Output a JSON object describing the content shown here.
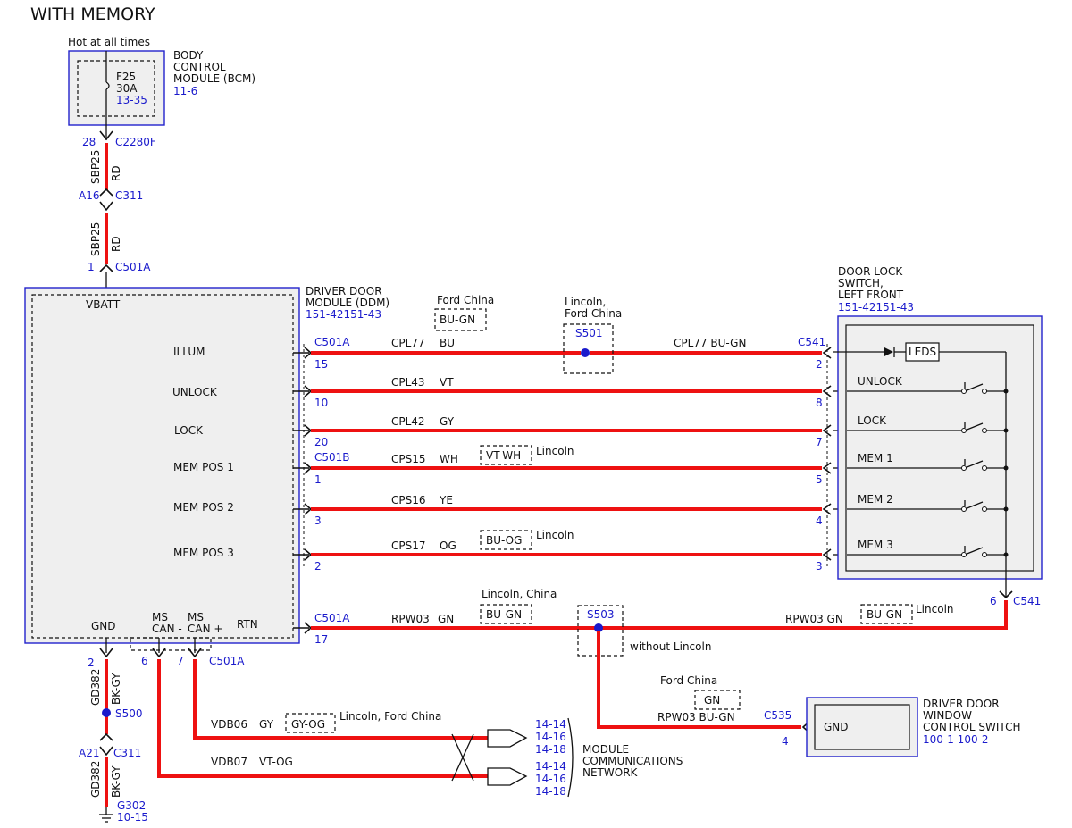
{
  "title": "WITH MEMORY",
  "colors": {
    "wire": "#ee1111",
    "blue_text": "#1a1acc",
    "splice": "#1a1acc",
    "module_fill": "#efefef"
  },
  "bcm": {
    "hot": "Hot at all times",
    "name": [
      "BODY",
      "CONTROL",
      "MODULE (BCM)"
    ],
    "ref": "11-6",
    "fuse": "F25",
    "fuse_amp": "30A",
    "fuse_ref": "13-35"
  },
  "power_feed": {
    "pin1": "28",
    "conn1": "C2280F",
    "circuit1": "SBP25",
    "color1": "RD",
    "pin2": "A16",
    "conn2": "C311",
    "circuit2": "SBP25",
    "color2": "RD",
    "pin3": "1",
    "conn3": "C501A"
  },
  "ddm": {
    "name": [
      "DRIVER DOOR",
      "MODULE (DDM)"
    ],
    "ref": "151-42151-43",
    "vbatt": "VBATT",
    "signals": [
      "ILLUM",
      "UNLOCK",
      "LOCK",
      "MEM POS 1",
      "MEM POS 2",
      "MEM POS 3"
    ],
    "gnd": "GND",
    "ms_can_minus": [
      "MS",
      "CAN -"
    ],
    "ms_can_plus": [
      "MS",
      "CAN +"
    ],
    "rtn": "RTN"
  },
  "switch": {
    "name": [
      "DOOR LOCK",
      "SWITCH,",
      "LEFT FRONT"
    ],
    "ref": "151-42151-43",
    "leds": "LEDS",
    "labels": [
      "UNLOCK",
      "LOCK",
      "MEM 1",
      "MEM 2",
      "MEM 3"
    ]
  },
  "wires": [
    {
      "conn_left": "C501A",
      "pin_left": "15",
      "circuit": "CPL77",
      "color": "BU",
      "pin_right": "2",
      "conn_right": "C541"
    },
    {
      "pin_left": "10",
      "circuit": "CPL43",
      "color": "VT",
      "pin_right": "8"
    },
    {
      "pin_left": "20",
      "circuit": "CPL42",
      "color": "GY",
      "pin_right": "7"
    },
    {
      "conn_left": "C501B",
      "pin_left": "1",
      "circuit": "CPS15",
      "color": "WH",
      "pin_right": "5"
    },
    {
      "pin_left": "3",
      "circuit": "CPS16",
      "color": "YE",
      "pin_right": "4"
    },
    {
      "pin_left": "2",
      "circuit": "CPS17",
      "color": "OG",
      "pin_right": "3"
    }
  ],
  "alt_colors": {
    "illum_note": "Ford China",
    "illum_alt": "BU-GN",
    "s501_note": [
      "Lincoln,",
      "Ford China"
    ],
    "s501": "S501",
    "illum_right": "CPL77  BU-GN",
    "mem1_alt": "VT-WH",
    "mem1_note": "Lincoln",
    "mem3_alt": "BU-OG",
    "mem3_note": "Lincoln"
  },
  "rtn_wire": {
    "conn": "C501A",
    "pin": "17",
    "circuit": "RPW03",
    "color": "GN",
    "note": "Lincoln, China",
    "alt": "BU-GN",
    "splice": "S503",
    "splice_note": "without Lincoln",
    "right_label": "RPW03  GN",
    "right_alt": "BU-GN",
    "right_note": "Lincoln",
    "sw_pin": "6",
    "sw_conn": "C541"
  },
  "window_switch": {
    "note": "Ford China",
    "alt": "GN",
    "wire": "RPW03  BU-GN",
    "conn": "C535",
    "pin": "4",
    "gnd": "GND",
    "name": [
      "DRIVER DOOR",
      "WINDOW",
      "CONTROL SWITCH"
    ],
    "ref": "100-1 100-2"
  },
  "ground": {
    "pin": "2",
    "circuit": "GD382",
    "color": "BK-GY",
    "splice": "S500",
    "pin2": "A21",
    "conn2": "C311",
    "ground": "G302",
    "ground_ref": "10-15"
  },
  "can": {
    "pin_minus": "6",
    "pin_plus": "7",
    "conn": "C501A",
    "wire1": "VDB06",
    "color1": "GY",
    "alt1": "GY-OG",
    "note1": "Lincoln, Ford China",
    "wire2": "VDB07",
    "color2": "VT-OG",
    "refs": [
      "14-14",
      "14-16",
      "14-18"
    ],
    "net_name": [
      "MODULE",
      "COMMUNICATIONS",
      "NETWORK"
    ]
  }
}
